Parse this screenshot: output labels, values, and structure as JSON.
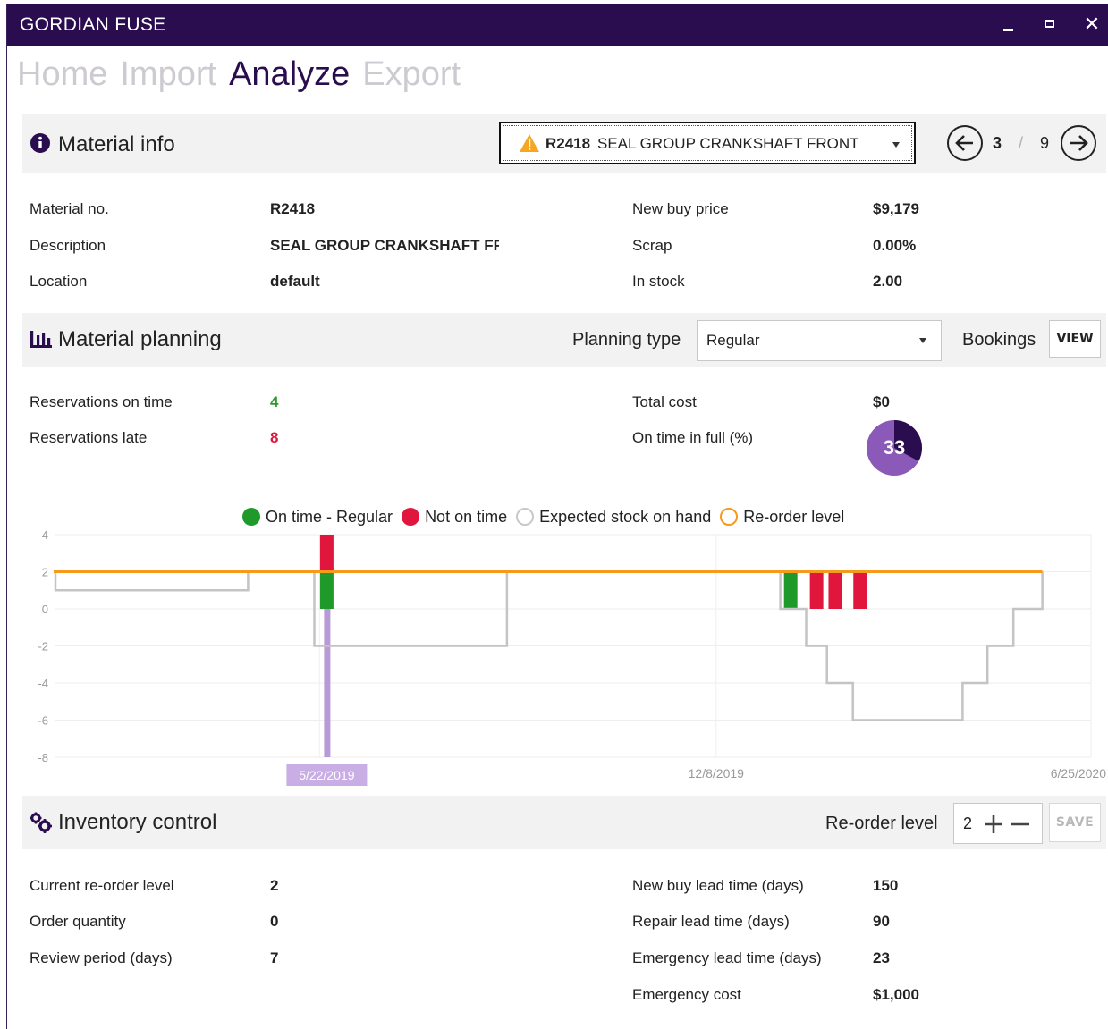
{
  "app": {
    "title": "GORDIAN FUSE"
  },
  "nav": {
    "tabs": [
      "Home",
      "Import",
      "Analyze",
      "Export"
    ],
    "active": "Analyze"
  },
  "material_info": {
    "heading": "Material info",
    "selector": {
      "code": "R2418",
      "name": "SEAL GROUP CRANKSHAFT FRONT"
    },
    "pager": {
      "current": "3",
      "separator": "/",
      "total": "9"
    },
    "fields_left": [
      {
        "label": "Material no.",
        "value": "R2418"
      },
      {
        "label": "Description",
        "value": "SEAL GROUP CRANKSHAFT FF"
      },
      {
        "label": "Location",
        "value": "default"
      }
    ],
    "fields_right": [
      {
        "label": "New buy price",
        "value": "$9,179"
      },
      {
        "label": "Scrap",
        "value": "0.00%"
      },
      {
        "label": "In stock",
        "value": "2.00"
      }
    ]
  },
  "material_planning": {
    "heading": "Material planning",
    "planning_type_label": "Planning type",
    "planning_type_value": "Regular",
    "bookings_label": "Bookings",
    "view_button": "VIEW",
    "fields_left": [
      {
        "label": "Reservations on time",
        "value": "4"
      },
      {
        "label": "Reservations late",
        "value": "8"
      }
    ],
    "fields_right": [
      {
        "label": "Total cost",
        "value": "$0"
      },
      {
        "label": "On time in full (%)",
        "value": "33"
      }
    ],
    "otif_fraction": 0.33
  },
  "chart_data": {
    "type": "line",
    "legend": [
      {
        "name": "On time - Regular",
        "color": "#1f9a2a",
        "style": "filled"
      },
      {
        "name": "Not on time",
        "color": "#e0163c",
        "style": "filled"
      },
      {
        "name": "Expected stock on hand",
        "color": "#c8c8c8",
        "style": "hollow"
      },
      {
        "name": "Re-order level",
        "color": "#f59a1b",
        "style": "hollow"
      }
    ],
    "y_ticks": [
      "4",
      "2",
      "0",
      "-2",
      "-4",
      "-6",
      "-8"
    ],
    "ylim": [
      -8,
      4
    ],
    "x_tick_labels": [
      "5/22/2019",
      "12/8/2019",
      "6/25/2020"
    ],
    "highlight_date": "5/22/2019",
    "reorder_level": 2,
    "bars_on_time": [
      {
        "x_frac": 0.262,
        "from": 0,
        "to": 2
      },
      {
        "x_frac": 0.71,
        "from": 0,
        "to": 2
      }
    ],
    "bars_late": [
      {
        "x_frac": 0.262,
        "from": 2,
        "to": 4
      },
      {
        "x_frac": 0.735,
        "from": 0,
        "to": 2
      },
      {
        "x_frac": 0.753,
        "from": 0,
        "to": 2
      },
      {
        "x_frac": 0.777,
        "from": 0,
        "to": 2
      }
    ],
    "stock_series": [
      [
        0.0,
        2
      ],
      [
        0.0,
        1
      ],
      [
        0.186,
        1
      ],
      [
        0.186,
        2
      ],
      [
        0.25,
        2
      ],
      [
        0.25,
        -2
      ],
      [
        0.436,
        -2
      ],
      [
        0.436,
        2
      ],
      [
        0.7,
        2
      ],
      [
        0.7,
        0
      ],
      [
        0.725,
        0
      ],
      [
        0.725,
        -2
      ],
      [
        0.745,
        -2
      ],
      [
        0.745,
        -4
      ],
      [
        0.77,
        -4
      ],
      [
        0.77,
        -6
      ],
      [
        0.876,
        -6
      ],
      [
        0.876,
        -4
      ],
      [
        0.9,
        -4
      ],
      [
        0.9,
        -2
      ],
      [
        0.925,
        -2
      ],
      [
        0.925,
        0
      ],
      [
        0.953,
        0
      ],
      [
        0.953,
        2
      ]
    ]
  },
  "inventory_control": {
    "heading": "Inventory control",
    "reorder_label": "Re-order level",
    "reorder_value": "2",
    "save_button": "SAVE",
    "fields_left": [
      {
        "label": "Current re-order level",
        "value": "2"
      },
      {
        "label": "Order quantity",
        "value": "0"
      },
      {
        "label": "Review period (days)",
        "value": "7"
      }
    ],
    "fields_right": [
      {
        "label": "New buy lead time (days)",
        "value": "150"
      },
      {
        "label": "Repair lead time (days)",
        "value": "90"
      },
      {
        "label": "Emergency lead time (days)",
        "value": "23"
      },
      {
        "label": "Emergency cost",
        "value": "$1,000"
      }
    ]
  }
}
